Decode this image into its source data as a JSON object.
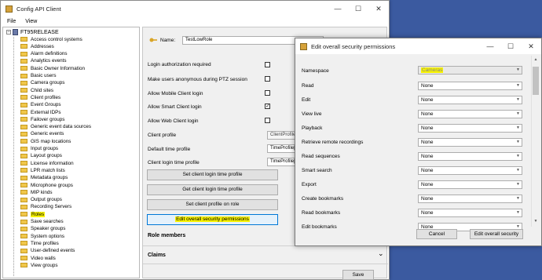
{
  "main_window": {
    "title": "Config API Client",
    "menu": [
      "File",
      "View"
    ],
    "controls": [
      "—",
      "☐",
      "✕"
    ]
  },
  "tree": {
    "root": "FT95RELEASE",
    "collapse_glyph": "−",
    "items": [
      "Access control systems",
      "Addresses",
      "Alarm definitions",
      "Analytics events",
      "Basic Owner Information",
      "Basic users",
      "Camera groups",
      "Child sites",
      "Client profiles",
      "Event Groups",
      "External IDPs",
      "Failover groups",
      "Generic event data sources",
      "Generic events",
      "GIS map locations",
      "Input groups",
      "Layout groups",
      "License information",
      "LPR match lists",
      "Metadata groups",
      "Microphone groups",
      "MIP kinds",
      "Output groups",
      "Recording Servers",
      "Roles",
      "Save searches",
      "Speaker groups",
      "System options",
      "Time profiles",
      "User-defined events",
      "Video walls",
      "View groups"
    ],
    "selected": "Roles"
  },
  "panel": {
    "name_label": "Name:",
    "name_value": "TestLowRole",
    "checkbox_rows": [
      {
        "label": "Login authorization required",
        "checked": false
      },
      {
        "label": "Make users anonymous during PTZ session",
        "checked": false
      },
      {
        "label": "Allow Mobile Client login",
        "checked": false
      },
      {
        "label": "Allow Smart Client login",
        "checked": true
      },
      {
        "label": "Allow Web Client login",
        "checked": false
      }
    ],
    "client_profile_label": "Client profile",
    "client_profile_value": "ClientProfile[8",
    "default_time_label": "Default time profile",
    "default_time_value": "TimeProfile[1",
    "client_login_label": "Client login time profile",
    "client_login_value": "TimeProfile[0",
    "buttons": [
      "Set client login time profile",
      "Get client login time profile",
      "Set client profile on role",
      "Edit overall security permissions"
    ],
    "role_members": "Role members",
    "claims": "Claims",
    "chevron": "⌄",
    "save": "Save"
  },
  "dialog": {
    "title": "Edit overall security permissions",
    "controls": [
      "—",
      "☐",
      "✕"
    ],
    "namespace_label": "Namespace",
    "namespace_value": "Cameras",
    "permissions": [
      {
        "label": "Read",
        "value": "None"
      },
      {
        "label": "Edit",
        "value": "None"
      },
      {
        "label": "View live",
        "value": "None"
      },
      {
        "label": "Playback",
        "value": "None"
      },
      {
        "label": "Retrieve remote recordings",
        "value": "None"
      },
      {
        "label": "Read sequences",
        "value": "None"
      },
      {
        "label": "Smart search",
        "value": "None"
      },
      {
        "label": "Export",
        "value": "None"
      },
      {
        "label": "Create bookmarks",
        "value": "None"
      },
      {
        "label": "Read bookmarks",
        "value": "None"
      },
      {
        "label": "Edit bookmarks",
        "value": "None"
      }
    ],
    "cancel": "Cancel",
    "ok": "Edit overall security"
  },
  "colors": {
    "highlight": "#f7f200",
    "desktop": "#3b5aa0"
  }
}
